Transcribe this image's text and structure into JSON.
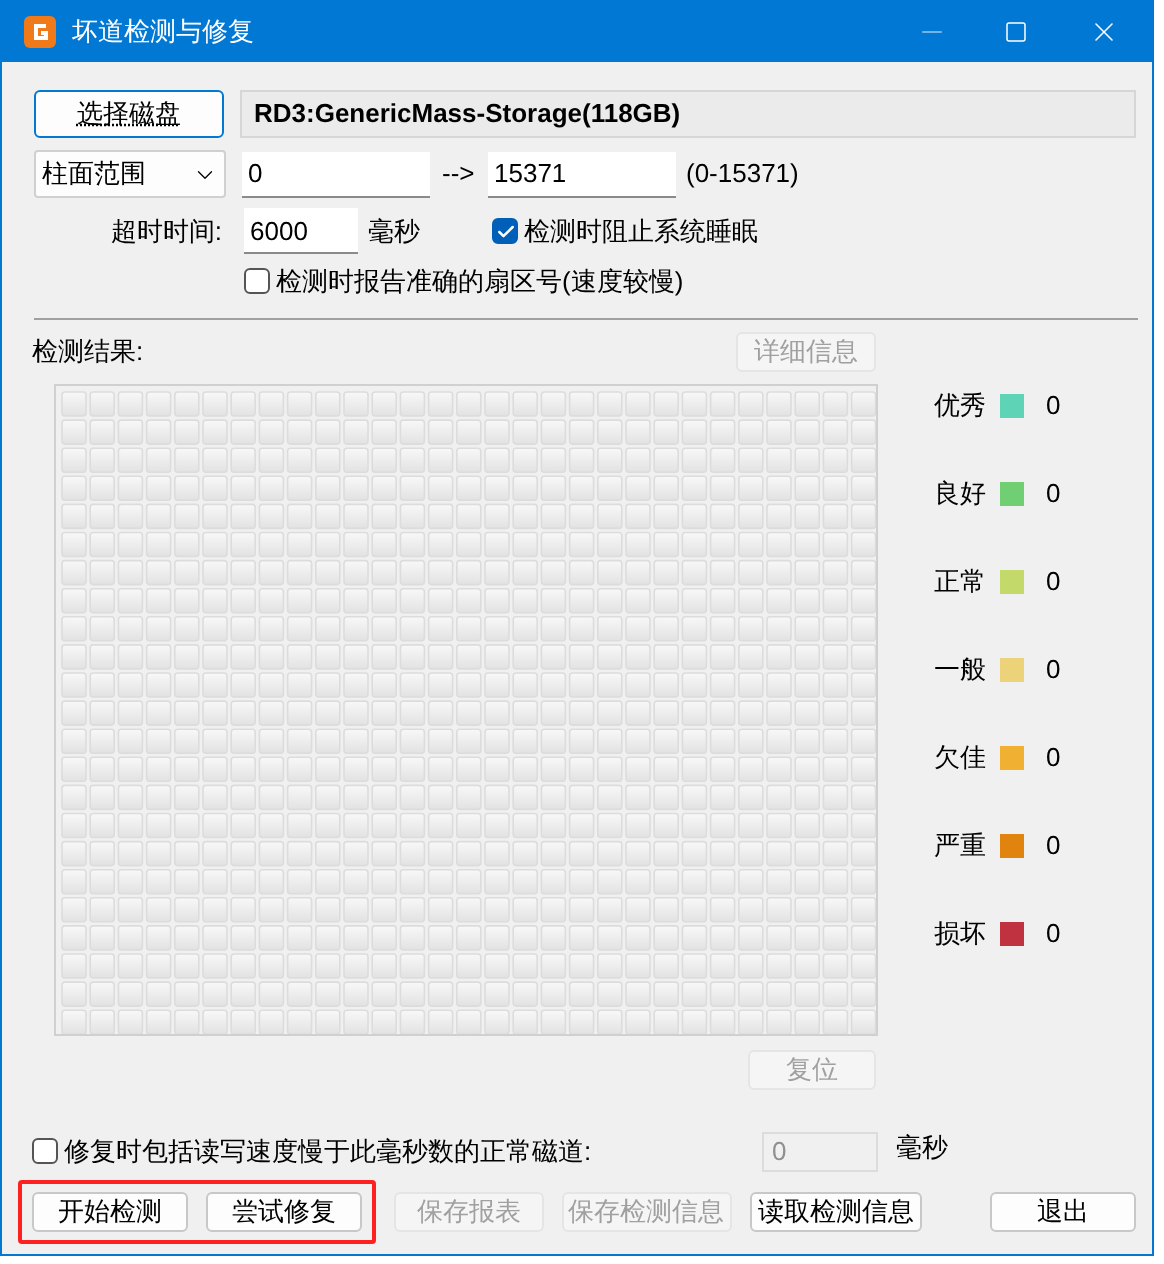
{
  "window": {
    "title": "坏道检测与修复"
  },
  "disk": {
    "button": "选择磁盘",
    "name": "RD3:GenericMass-Storage(118GB)"
  },
  "range": {
    "mode": "柱面范围",
    "from": "0",
    "arrow": "-->",
    "to": "15371",
    "hint": "(0-15371)"
  },
  "timeout": {
    "label": "超时时间:",
    "value": "6000",
    "unit": "毫秒"
  },
  "options": [
    {
      "label": "检测时阻止系统睡眠",
      "checked": true
    },
    {
      "label": "检测时报告准确的扇区号(速度较慢)",
      "checked": false
    }
  ],
  "results": {
    "label": "检测结果:",
    "detail_button": {
      "label": "详细信息",
      "disabled": true
    },
    "reset_button": {
      "label": "复位",
      "disabled": true
    }
  },
  "legend": [
    {
      "label": "优秀",
      "color": "#5fd3b5",
      "count": "0"
    },
    {
      "label": "良好",
      "color": "#6fcf72",
      "count": "0"
    },
    {
      "label": "正常",
      "color": "#c3d96a",
      "count": "0"
    },
    {
      "label": "一般",
      "color": "#ecd37a",
      "count": "0"
    },
    {
      "label": "欠佳",
      "color": "#f0b032",
      "count": "0"
    },
    {
      "label": "严重",
      "color": "#e0830f",
      "count": "0"
    },
    {
      "label": "损坏",
      "color": "#c0323f",
      "count": "0"
    }
  ],
  "slow_track": {
    "label": "修复时包括读写速度慢于此毫秒数的正常磁道:",
    "checked": false,
    "value": "0",
    "disabled": true,
    "unit": "毫秒"
  },
  "actions": [
    {
      "label": "开始检测",
      "disabled": false,
      "highlighted": true
    },
    {
      "label": "尝试修复",
      "disabled": false,
      "highlighted": true
    },
    {
      "label": "保存报表",
      "disabled": true,
      "highlighted": false
    },
    {
      "label": "保存检测信息",
      "disabled": true,
      "highlighted": false
    },
    {
      "label": "读取检测信息",
      "disabled": false,
      "highlighted": false
    },
    {
      "label": "退出",
      "disabled": false,
      "highlighted": false
    }
  ]
}
